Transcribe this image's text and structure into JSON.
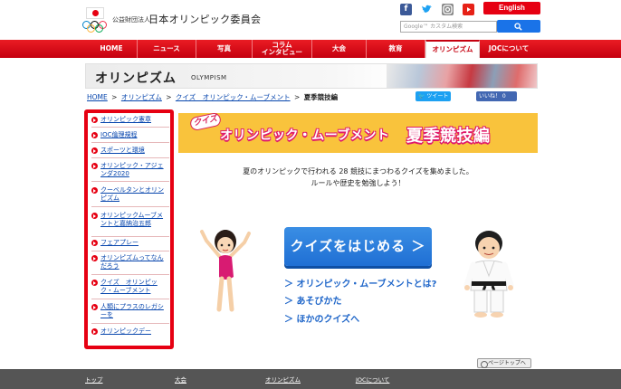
{
  "header": {
    "org_small": "公益財団法人",
    "org_name": "日本オリンピック委員会",
    "english_label": "English",
    "search_placeholder": "Google™ カスタム検索",
    "social": [
      "facebook-icon",
      "twitter-icon",
      "instagram-icon",
      "youtube-icon"
    ]
  },
  "nav": {
    "items": [
      {
        "label": "HOME"
      },
      {
        "label": "ニュース"
      },
      {
        "label": "写真"
      },
      {
        "label": "コラム\nインタビュー"
      },
      {
        "label": "大会"
      },
      {
        "label": "教育"
      },
      {
        "label": "オリンピズム"
      },
      {
        "label": "JOCについて"
      }
    ]
  },
  "banner": {
    "title": "オリンピズム",
    "subtitle": "OLYMPISM"
  },
  "breadcrumb": {
    "home": "HOME",
    "olympism": "オリンピズム",
    "quiz": "クイズ　オリンピック・ムーブメント",
    "current": "夏季競技編",
    "sep": ">"
  },
  "share": {
    "tweet": "ツイート",
    "like": "いいね！ 0"
  },
  "sidebar": {
    "items": [
      "オリンピック憲章",
      "IOC倫理規程",
      "スポーツと環境",
      "オリンピック・アジェンダ2020",
      "クーベルタンとオリンピズム",
      "オリンピックムーブメントと嘉納治五郎",
      "フェアプレー",
      "オリンピズムってなんだろう",
      "クイズ　オリンピック・ムーブメント",
      "人類にプラスのレガシーを",
      "オリンピックデー"
    ]
  },
  "main": {
    "quiz_badge": "クイズ",
    "title_main": "オリンピック・ムーブメント",
    "title_sub": "夏季競技編",
    "intro_line1": "夏のオリンピックで行われる 28 競技にまつわるクイズを集めました。",
    "intro_line2": "ルールや歴史を勉強しよう！",
    "start_button": "クイズをはじめる ＞",
    "links": [
      "＞ オリンピック・ムーブメントとは?",
      "＞ あそびかた",
      "＞ ほかのクイズへ"
    ],
    "page_top": "ページトップへ"
  },
  "footer": {
    "items": [
      "トップ",
      "大会",
      "オリンピズム",
      "JOCについて"
    ]
  },
  "colors": {
    "brand_red": "#e60012",
    "quiz_yellow": "#f9c33c",
    "button_blue": "#1f6fd4",
    "link_blue": "#0645ad"
  }
}
